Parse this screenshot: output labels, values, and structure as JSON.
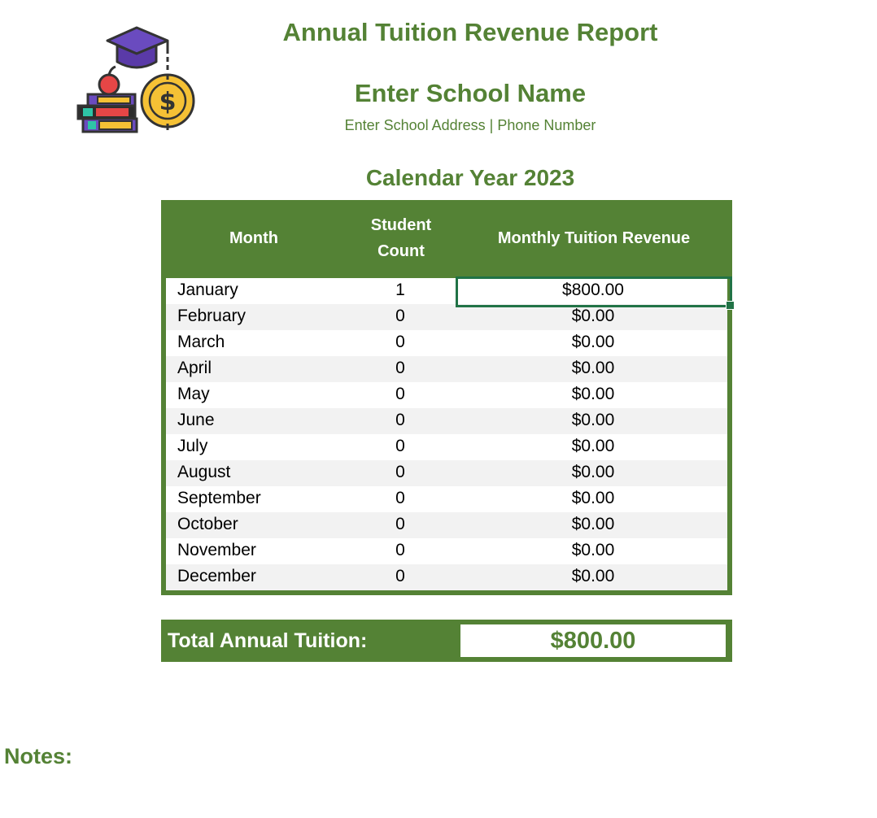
{
  "report": {
    "title": "Annual Tuition Revenue Report",
    "school_name": "Enter School Name",
    "school_address": "Enter School Address | Phone Number",
    "calendar_year": "Calendar Year 2023"
  },
  "table": {
    "headers": {
      "month": "Month",
      "student_count_line1": "Student",
      "student_count_line2": "Count",
      "revenue": "Monthly Tuition Revenue"
    },
    "rows": [
      {
        "month": "January",
        "count": "1",
        "revenue": "$800.00"
      },
      {
        "month": "February",
        "count": "0",
        "revenue": "$0.00"
      },
      {
        "month": "March",
        "count": "0",
        "revenue": "$0.00"
      },
      {
        "month": "April",
        "count": "0",
        "revenue": "$0.00"
      },
      {
        "month": "May",
        "count": "0",
        "revenue": "$0.00"
      },
      {
        "month": "June",
        "count": "0",
        "revenue": "$0.00"
      },
      {
        "month": "July",
        "count": "0",
        "revenue": "$0.00"
      },
      {
        "month": "August",
        "count": "0",
        "revenue": "$0.00"
      },
      {
        "month": "September",
        "count": "0",
        "revenue": "$0.00"
      },
      {
        "month": "October",
        "count": "0",
        "revenue": "$0.00"
      },
      {
        "month": "November",
        "count": "0",
        "revenue": "$0.00"
      },
      {
        "month": "December",
        "count": "0",
        "revenue": "$0.00"
      }
    ]
  },
  "total": {
    "label": "Total Annual Tuition:",
    "value": "$800.00"
  },
  "notes": {
    "label": "Notes:"
  },
  "icons": {
    "logo": "graduation-cap-books-dollar-icon"
  },
  "colors": {
    "accent_green": "#548235",
    "selection_green": "#217346",
    "row_alt": "#f2f2f2"
  }
}
